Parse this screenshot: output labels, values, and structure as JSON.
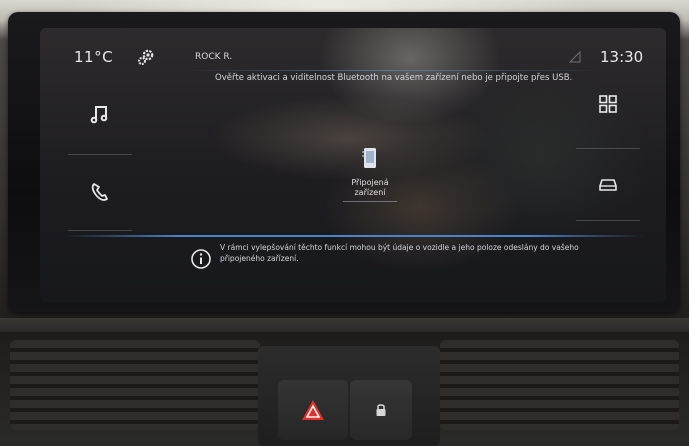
{
  "status_bar": {
    "temperature": "11°C",
    "source_label": "ROCK R.",
    "clock": "13:30",
    "settings_icon": "gear-icon",
    "signal_icon": "signal-icon"
  },
  "notice_top": "Ověřte aktivaci a viditelnost Bluetooth na vašem zařízení nebo je připojte přes USB.",
  "left_menu": [
    {
      "icon": "music-note-icon"
    },
    {
      "icon": "phone-icon"
    }
  ],
  "right_menu": [
    {
      "icon": "apps-grid-icon"
    },
    {
      "icon": "car-icon"
    }
  ],
  "center_tile": {
    "icon": "phone-device-icon",
    "label_line1": "Připojená",
    "label_line2": "zařízení"
  },
  "info_notice": {
    "icon": "info-icon",
    "text": "V rámci vylepšování těchto funkcí mohou být údaje o vozidle a jeho poloze odeslány do vašeho připojeného zařízení."
  },
  "colors": {
    "accent_line": "#4a84c8",
    "hazard_red": "#e0302a",
    "text": "#e8e8ea"
  }
}
